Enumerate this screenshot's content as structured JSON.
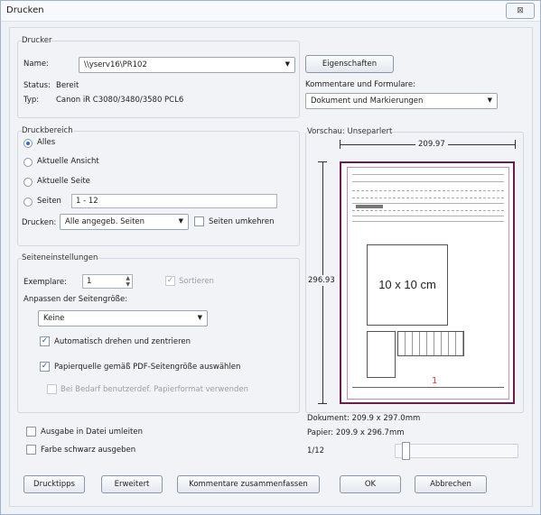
{
  "window": {
    "title": "Drucken",
    "close_symbol": "⊠"
  },
  "printer": {
    "group_label": "Drucker",
    "name_label": "Name:",
    "name_value": "\\\\yserv16\\PR102",
    "status_label": "Status:",
    "status_value": "Bereit",
    "type_label": "Typ:",
    "type_value": "Canon iR C3080/3480/3580 PCL6",
    "properties_button": "Eigenschaften",
    "comments_label": "Kommentare und Formulare:",
    "comments_value": "Dokument und Markierungen"
  },
  "print_range": {
    "group_label": "Druckbereich",
    "options": [
      "Alles",
      "Aktuelle Ansicht",
      "Aktuelle Seite",
      "Seiten"
    ],
    "selected": "Alles",
    "pages_value": "1 - 12",
    "print_label": "Drucken:",
    "print_value": "Alle angegeb. Seiten",
    "reverse_label": "Seiten umkehren"
  },
  "page_settings": {
    "group_label": "Seiteneinstellungen",
    "copies_label": "Exemplare:",
    "copies_value": "1",
    "collate_label": "Sortieren",
    "fit_label": "Anpassen der Seitengröße:",
    "fit_value": "Keine",
    "auto_rotate_label": "Automatisch drehen und zentrieren",
    "paper_source_label": "Papierquelle gemäß PDF-Seitengröße auswählen",
    "custom_paper_label": "Bei Bedarf benutzerdef. Papierformat verwenden"
  },
  "output": {
    "to_file_label": "Ausgabe in Datei umleiten",
    "black_label": "Farbe schwarz ausgeben"
  },
  "preview": {
    "label": "Vorschau: Unseparlert",
    "width_dim": "209.97",
    "height_dim": "296.93",
    "box_text": "10 x 10 cm",
    "page_mark": "1",
    "document_info": "Dokument: 209.9 x 297.0mm",
    "paper_info": "Papier: 209.9 x 296.7mm",
    "page_counter": "1/12",
    "page_position_fraction": 0.0
  },
  "buttons": {
    "tips": "Drucktipps",
    "advanced": "Erweitert",
    "summarize": "Kommentare zusammenfassen",
    "ok": "OK",
    "cancel": "Abbrechen"
  },
  "colors": {
    "preview_border": "#6a1d4f",
    "accent": "#2a6fd0"
  }
}
